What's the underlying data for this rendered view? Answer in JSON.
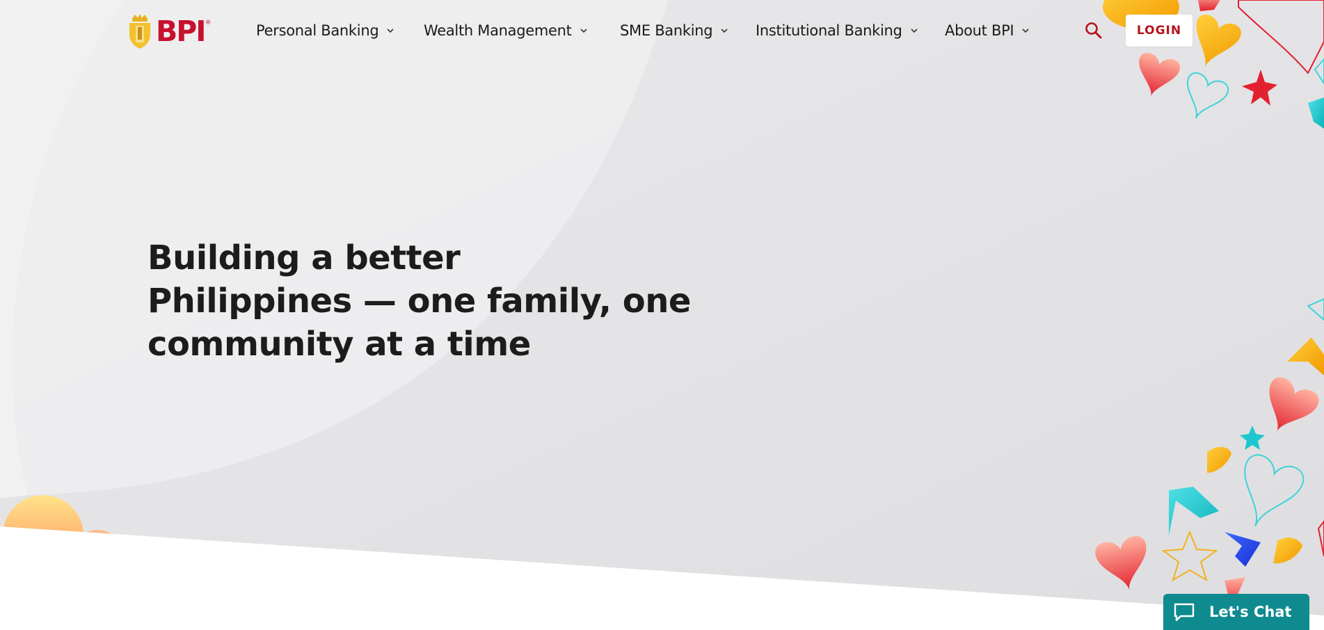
{
  "brand": {
    "name": "BPI",
    "colors": {
      "primary_red": "#c8102e",
      "gold": "#f2b21b",
      "teal": "#0f8a8f",
      "hero_background": "#e3e3e5",
      "text_dark": "#1c1c1c"
    }
  },
  "header": {
    "nav": [
      {
        "label": "Personal Banking"
      },
      {
        "label": "Wealth Management"
      },
      {
        "label": "SME Banking"
      },
      {
        "label": "Institutional Banking"
      },
      {
        "label": "About BPI"
      }
    ],
    "search_icon": "search-icon",
    "login_label": "LOGIN"
  },
  "hero": {
    "headline": [
      "Building a better",
      "Philippines — one family, one",
      "community at a time"
    ]
  },
  "chat": {
    "icon": "chat-bubble-icon",
    "label": "Let's Chat"
  }
}
